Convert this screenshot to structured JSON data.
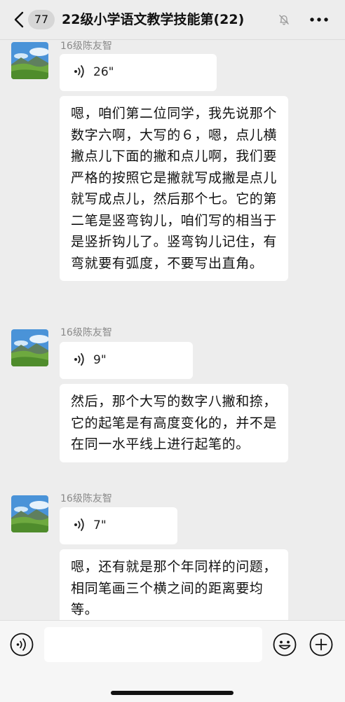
{
  "header": {
    "unread_count": "77",
    "title": "22级小学语文教学技能第(22)",
    "icons": {
      "back": "chevron-left-icon",
      "mute": "bell-slash-icon",
      "more": "more-dots-icon"
    }
  },
  "messages": [
    {
      "sender": "16级陈友智",
      "voice_duration": "26\"",
      "text": "嗯，咱们第二位同学，我先说那个数字六啊，大写的６，嗯，点儿横撇点儿下面的撇和点儿啊，我们要严格的按照它是撇就写成撇是点儿就写成点儿，然后那个七。它的第二笔是竖弯钩儿，咱们写的相当于是竖折钩儿了。竖弯钩儿记住，有弯就要有弧度，不要写出直角。"
    },
    {
      "sender": "16级陈友智",
      "voice_duration": "9\"",
      "text": "然后，那个大写的数字八撇和捺，它的起笔是有高度变化的，并不是在同一水平线上进行起笔的。"
    },
    {
      "sender": "16级陈友智",
      "voice_duration": "7\"",
      "text": "嗯，还有就是那个年同样的问题，相同笔画三个横之间的距离要均等。"
    }
  ],
  "bottom_bar": {
    "input_value": "",
    "icons": {
      "voice": "voice-input-icon",
      "emoji": "emoji-icon",
      "plus": "plus-icon"
    }
  },
  "colors": {
    "background": "#ededed",
    "bubble": "#ffffff",
    "sender_text": "#8a8a8a"
  }
}
